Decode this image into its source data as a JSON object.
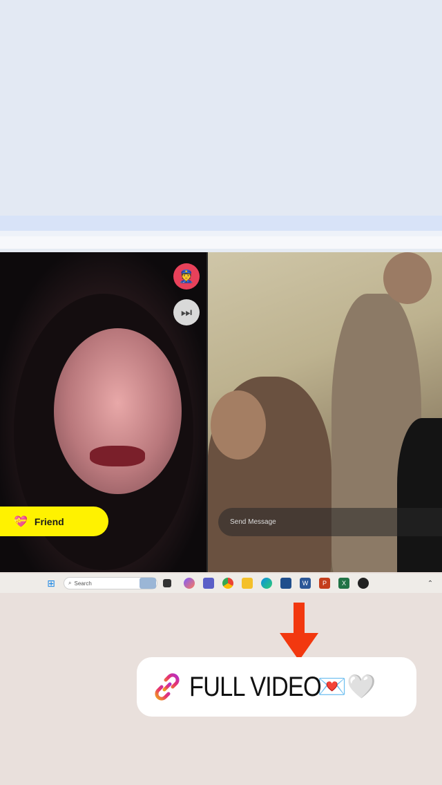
{
  "videochat": {
    "friend_label": "Friend",
    "send_placeholder": "Send Message"
  },
  "taskbar": {
    "search_placeholder": "Search"
  },
  "overlay": {
    "full_video_label": "FULL VIDEO",
    "emojis": "💌🤍"
  },
  "colors": {
    "friend_button": "#fff200",
    "report_button": "#e8415a",
    "arrow": "#f2380f"
  }
}
